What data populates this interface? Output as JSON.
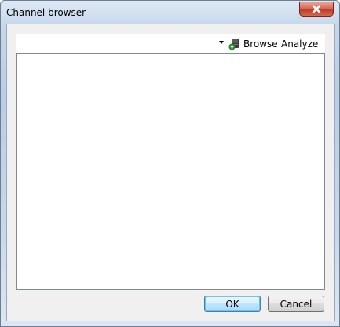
{
  "window": {
    "title": "Channel browser"
  },
  "toolbar": {
    "browse_label": "Browse",
    "analyze_label": "Analyze"
  },
  "footer": {
    "ok_label": "OK",
    "cancel_label": "Cancel"
  },
  "colors": {
    "close_button": "#c43a26",
    "ok_border": "#3c7fb1"
  }
}
